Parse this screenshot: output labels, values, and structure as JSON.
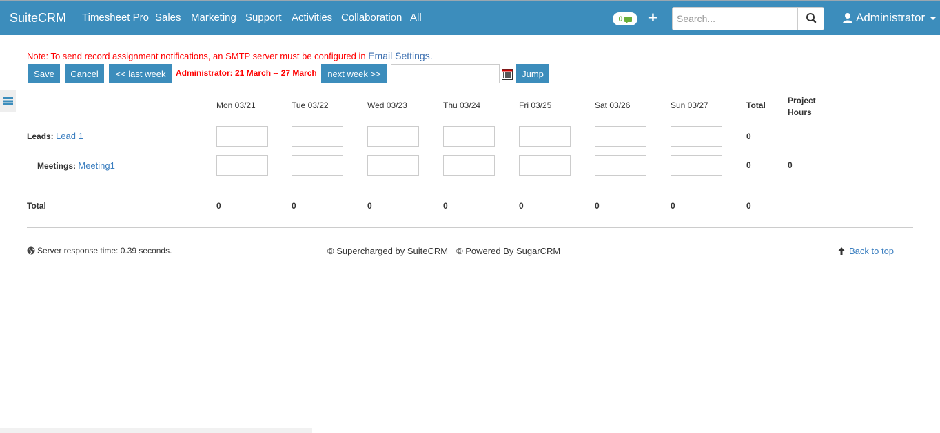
{
  "navbar": {
    "brand": "SuiteCRM",
    "items": [
      "Timesheet Pro",
      "Sales",
      "Marketing",
      "Support",
      "Activities",
      "Collaboration",
      "All"
    ],
    "notifications_count": "0",
    "search_placeholder": "Search...",
    "user_name": "Administrator",
    "colors": {
      "bar": "#3c8dbc",
      "notification": "#6aaf3a"
    }
  },
  "notice": {
    "text": "Note: To send record assignment notifications, an SMTP server must be configured in ",
    "link": "Email Settings."
  },
  "toolbar": {
    "save": "Save",
    "cancel": "Cancel",
    "last_week": "<< last week",
    "range": "Administrator: 21 March -- 27 March",
    "next_week": "next week >>",
    "date_value": "",
    "jump": "Jump"
  },
  "timesheet": {
    "columns": [
      "Mon 03/21",
      "Tue 03/22",
      "Wed 03/23",
      "Thu 03/24",
      "Fri 03/25",
      "Sat 03/26",
      "Sun 03/27"
    ],
    "total_header": "Total",
    "project_hours_header_line1": "Project",
    "project_hours_header_line2": "Hours",
    "rows": [
      {
        "type": "Leads:",
        "name": "Lead 1",
        "hours": [
          "",
          "",
          "",
          "",
          "",
          "",
          ""
        ],
        "total": "0",
        "project_hours": ""
      },
      {
        "type": "Meetings:",
        "name": "Meeting1",
        "hours": [
          "",
          "",
          "",
          "",
          "",
          "",
          ""
        ],
        "total": "0",
        "project_hours": "0"
      }
    ],
    "totals_label": "Total",
    "totals": [
      "0",
      "0",
      "0",
      "0",
      "0",
      "0",
      "0"
    ],
    "grand_total": "0"
  },
  "footer": {
    "response_time": "Server response time: 0.39 seconds.",
    "supercharged": "© Supercharged by SuiteCRM",
    "powered": "© Powered By SugarCRM",
    "back_to_top": "Back to top"
  }
}
